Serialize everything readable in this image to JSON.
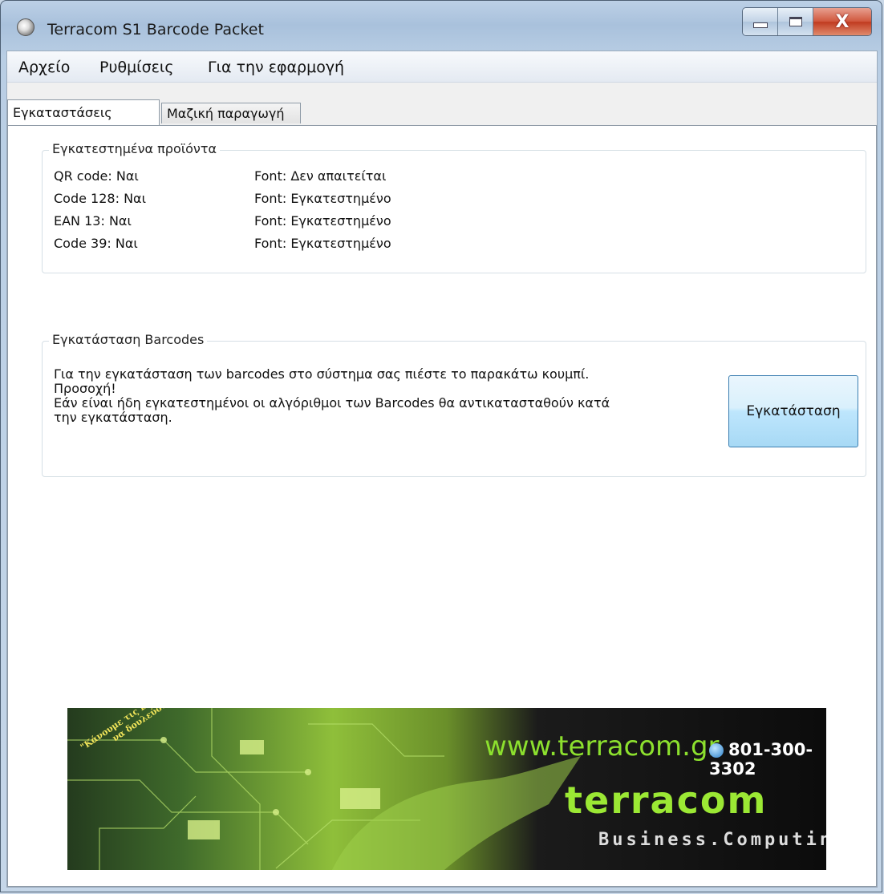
{
  "window": {
    "title": "Terracom S1 Barcode Packet",
    "close_glyph": "X"
  },
  "menu": [
    "Αρχείο",
    "Ρυθμίσεις",
    "Για την εφαρμογή"
  ],
  "tabs": [
    {
      "label": "Εγκαταστάσεις",
      "active": true
    },
    {
      "label": "Μαζική παραγωγή",
      "active": false
    }
  ],
  "installed_products": {
    "title": "Εγκατεστημένα προϊόντα",
    "rows": [
      {
        "product": "QR code: Ναι",
        "font": "Font: Δεν απαιτείται"
      },
      {
        "product": "Code 128: Ναι",
        "font": "Font: Εγκατεστημένο"
      },
      {
        "product": "EAN 13: Ναι",
        "font": "Font: Εγκατεστημένο"
      },
      {
        "product": "Code 39: Ναι",
        "font": "Font: Εγκατεστημένο"
      }
    ]
  },
  "install_barcodes": {
    "title": "Εγκατάσταση Barcodes",
    "line1": "Για την εγκατάσταση των barcodes στο σύστημα σας πιέστε το παρακάτω κουμπί.",
    "line2": "Προσοχή!",
    "line3": "Εάν είναι ήδη εγκατεστημένοι οι αλγόριθμοι των Barcodes θα αντικατασταθούν κατά",
    "line4": "την εγκατάσταση.",
    "button_label": "Εγκατάσταση"
  },
  "banner": {
    "url": "www.terracom.gr",
    "phone": "801-300-3302",
    "logo": "terracom",
    "tagline": "Business.Computing",
    "slogan": "\"Κάνουμε τις Επιχειρήσεις να δουλεύουν\"",
    "accent_color": "#8ce02e"
  }
}
